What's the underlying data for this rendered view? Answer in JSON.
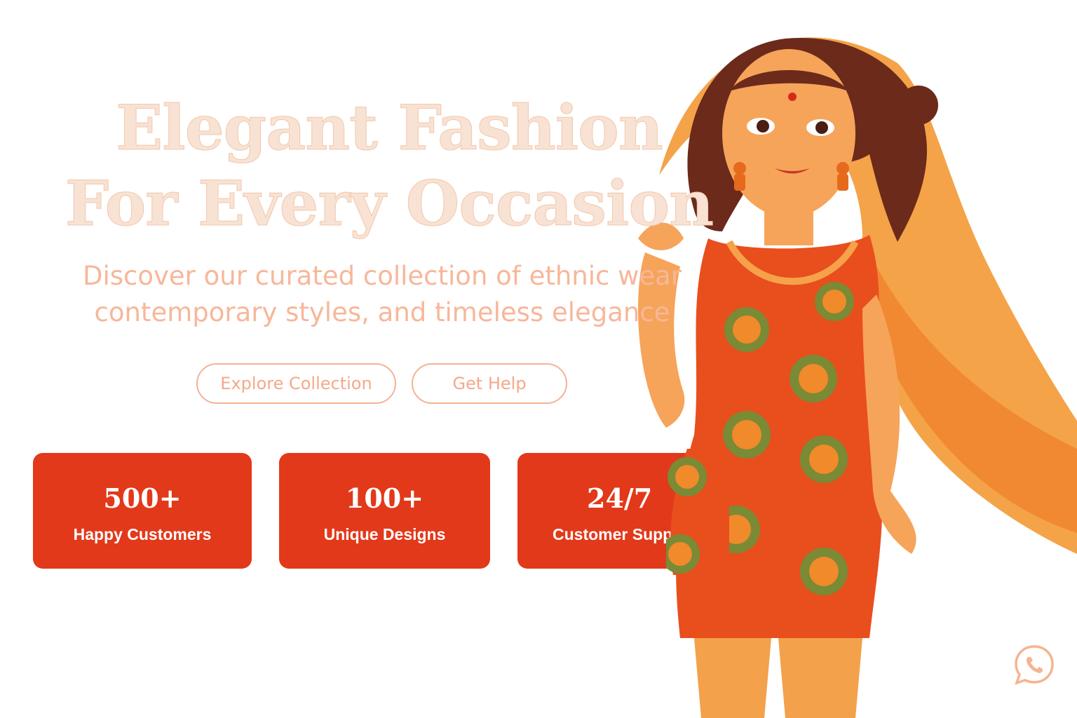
{
  "hero": {
    "title_line1": "Elegant Fashion",
    "title_line2": "For Every Occasion",
    "subtitle_line1": "Discover our curated collection of ethnic wear",
    "subtitle_line2": "contemporary styles, and timeless elegance"
  },
  "buttons": {
    "explore": "Explore Collection",
    "help": "Get Help"
  },
  "stats": [
    {
      "value": "500+",
      "label": "Happy Customers"
    },
    {
      "value": "100+",
      "label": "Unique Designs"
    },
    {
      "value": "24/7",
      "label": "Customer Supp"
    }
  ],
  "colors": {
    "accent": "#e2391a",
    "title": "#f8e2d3",
    "subtitle": "#f7b79a",
    "button_border": "#f4b294"
  },
  "icons": {
    "whatsapp": "whatsapp-icon"
  }
}
